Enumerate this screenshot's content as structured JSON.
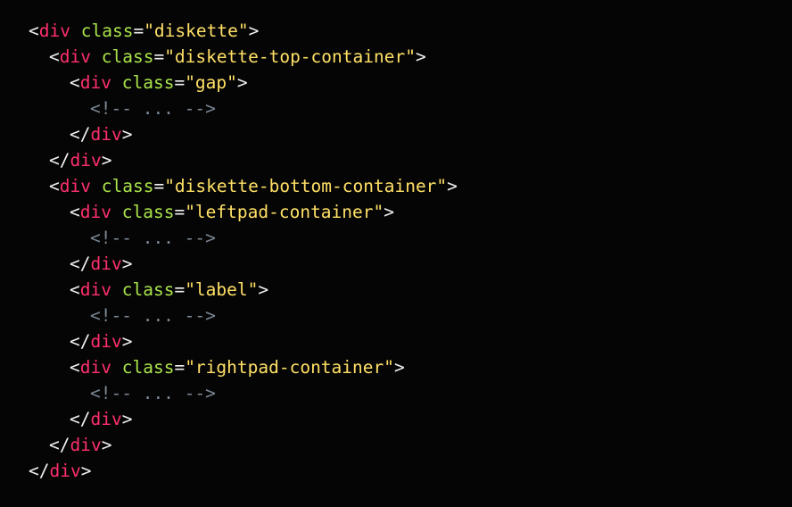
{
  "editor": {
    "lines": [
      {
        "type": "open",
        "indent": 0,
        "tag": "div",
        "attr": "class",
        "value": "\"diskette\""
      },
      {
        "type": "open",
        "indent": 1,
        "tag": "div",
        "attr": "class",
        "value": "\"diskette-top-container\""
      },
      {
        "type": "open",
        "indent": 2,
        "tag": "div",
        "attr": "class",
        "value": "\"gap\""
      },
      {
        "type": "comment",
        "indent": 3,
        "text": "<!-- ... -->"
      },
      {
        "type": "close",
        "indent": 2,
        "tag": "div"
      },
      {
        "type": "close",
        "indent": 1,
        "tag": "div"
      },
      {
        "type": "open",
        "indent": 1,
        "tag": "div",
        "attr": "class",
        "value": "\"diskette-bottom-container\""
      },
      {
        "type": "open",
        "indent": 2,
        "tag": "div",
        "attr": "class",
        "value": "\"leftpad-container\""
      },
      {
        "type": "comment",
        "indent": 3,
        "text": "<!-- ... -->"
      },
      {
        "type": "close",
        "indent": 2,
        "tag": "div"
      },
      {
        "type": "open",
        "indent": 2,
        "tag": "div",
        "attr": "class",
        "value": "\"label\""
      },
      {
        "type": "comment",
        "indent": 3,
        "text": "<!-- ... -->"
      },
      {
        "type": "close",
        "indent": 2,
        "tag": "div"
      },
      {
        "type": "open",
        "indent": 2,
        "tag": "div",
        "attr": "class",
        "value": "\"rightpad-container\""
      },
      {
        "type": "comment",
        "indent": 3,
        "text": "<!-- ... -->"
      },
      {
        "type": "close",
        "indent": 2,
        "tag": "div"
      },
      {
        "type": "close",
        "indent": 1,
        "tag": "div"
      },
      {
        "type": "close",
        "indent": 0,
        "tag": "div"
      }
    ]
  },
  "colors": {
    "background": "#050505",
    "tag": "#ff2f6d",
    "attribute": "#a9e34b",
    "string": "#ffe066",
    "comment": "#7b8794",
    "punctuation": "#f2f2f2"
  }
}
